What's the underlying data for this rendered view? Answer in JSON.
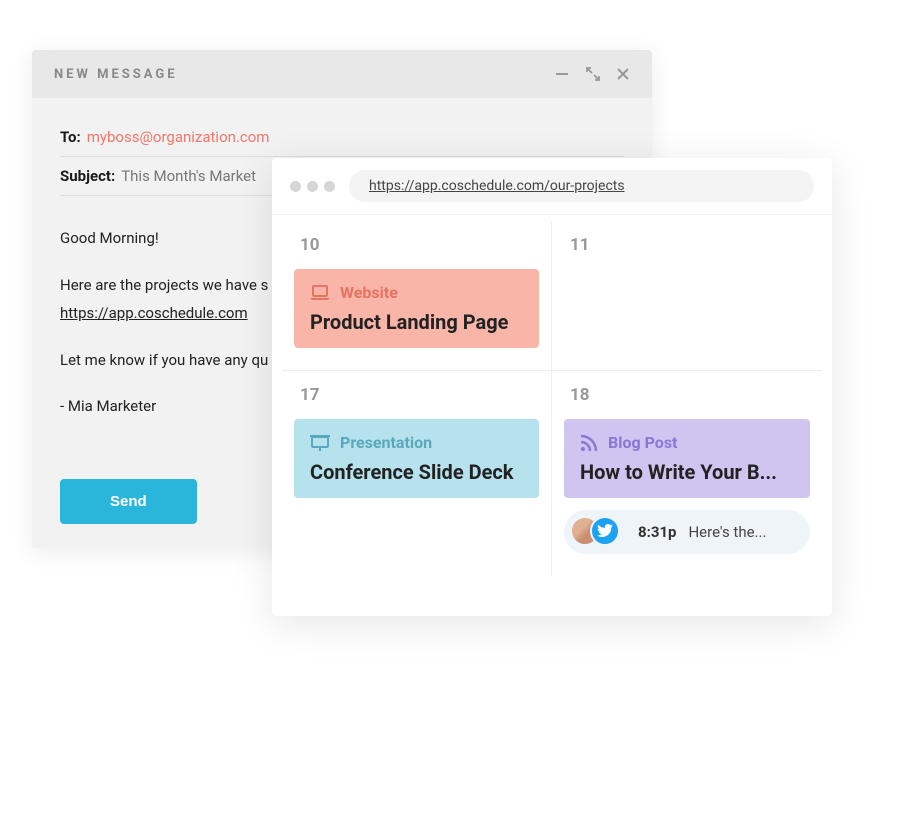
{
  "email": {
    "title": "NEW MESSAGE",
    "to_label": "To:",
    "to_value": "myboss@organization.com",
    "subject_label": "Subject:",
    "subject_value": "This Month's Market",
    "body": {
      "greeting": "Good Morning!",
      "line1": "Here are the projects we have s",
      "link": "https://app.coschedule.com",
      "line2": "Let me know if you have any qu",
      "signoff": "- Mia Marketer"
    },
    "send_label": "Send"
  },
  "browser": {
    "url": "https://app.coschedule.com/our-projects",
    "cells": [
      {
        "date": "10",
        "card": {
          "type": "Website",
          "title": "Product Landing Page",
          "style": "website"
        }
      },
      {
        "date": "11"
      },
      {
        "date": "17",
        "card": {
          "type": "Presentation",
          "title": "Conference Slide Deck",
          "style": "presentation"
        }
      },
      {
        "date": "18",
        "card": {
          "type": "Blog Post",
          "title": "How to Write Your B...",
          "style": "blog"
        },
        "event": {
          "time": "8:31p",
          "text": "Here's the..."
        }
      }
    ]
  }
}
